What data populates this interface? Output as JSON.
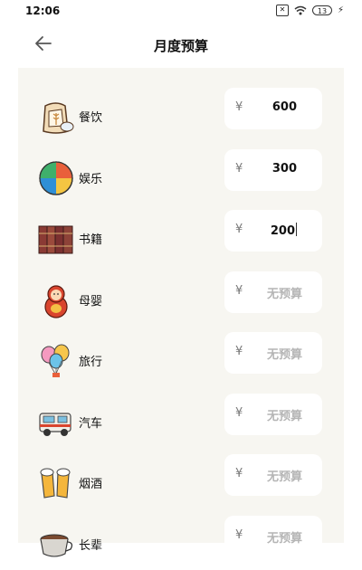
{
  "status": {
    "time": "12:06",
    "sim": "✕",
    "battery": "13",
    "charging": "⚡"
  },
  "header": {
    "title": "月度预算"
  },
  "currency": "¥",
  "categories": [
    {
      "name": "餐饮",
      "value": "600",
      "icon": "flour-bag-icon"
    },
    {
      "name": "娱乐",
      "value": "300",
      "icon": "beach-ball-icon"
    },
    {
      "name": "书籍",
      "value": "200",
      "icon": "books-icon"
    },
    {
      "name": "母婴",
      "value": "无预算",
      "icon": "nesting-doll-icon"
    },
    {
      "name": "旅行",
      "value": "无预算",
      "icon": "balloons-icon"
    },
    {
      "name": "汽车",
      "value": "无预算",
      "icon": "camper-van-icon"
    },
    {
      "name": "烟酒",
      "value": "无预算",
      "icon": "beer-cheers-icon"
    },
    {
      "name": "长辈",
      "value": "无预算",
      "icon": "coffee-cup-icon"
    }
  ]
}
